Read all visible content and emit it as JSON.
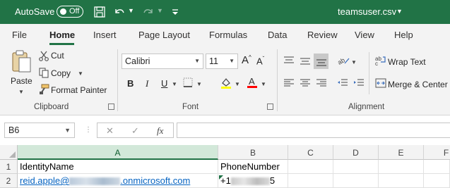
{
  "titlebar": {
    "autosave_label": "AutoSave",
    "autosave_state": "Off",
    "filename": "teamsuser.csv",
    "icons": [
      "save-icon",
      "undo-icon",
      "redo-icon",
      "customize-qat-icon",
      "filename-caret-icon"
    ]
  },
  "tabs": [
    "File",
    "Home",
    "Insert",
    "Page Layout",
    "Formulas",
    "Data",
    "Review",
    "View",
    "Help"
  ],
  "active_tab": "Home",
  "accent_color": "#217346",
  "ribbon": {
    "clipboard": {
      "paste": "Paste",
      "cut": "Cut",
      "copy": "Copy",
      "format_painter": "Format Painter",
      "label": "Clipboard"
    },
    "font": {
      "family": "Calibri",
      "size": "11",
      "bold": "B",
      "italic": "I",
      "underline": "U",
      "grow": "A",
      "shrink": "A",
      "fill_color": "#ffff00",
      "font_color": "#ff0000",
      "label": "Font"
    },
    "alignment": {
      "wrap_text": "Wrap Text",
      "merge_center": "Merge & Center",
      "label": "Alignment"
    }
  },
  "formula_bar": {
    "name_box": "B6",
    "fx": "fx",
    "formula": ""
  },
  "columns": [
    "A",
    "B",
    "C",
    "D",
    "E",
    "F"
  ],
  "selected_column": "A",
  "rows": [
    {
      "num": "1",
      "a": "IdentityName",
      "b": "PhoneNumber"
    },
    {
      "num": "2",
      "a_prefix": "reid.apple@",
      "a_suffix": ".onmicrosoft.com",
      "b_prefix": "+1",
      "b_suffix": "5"
    }
  ]
}
